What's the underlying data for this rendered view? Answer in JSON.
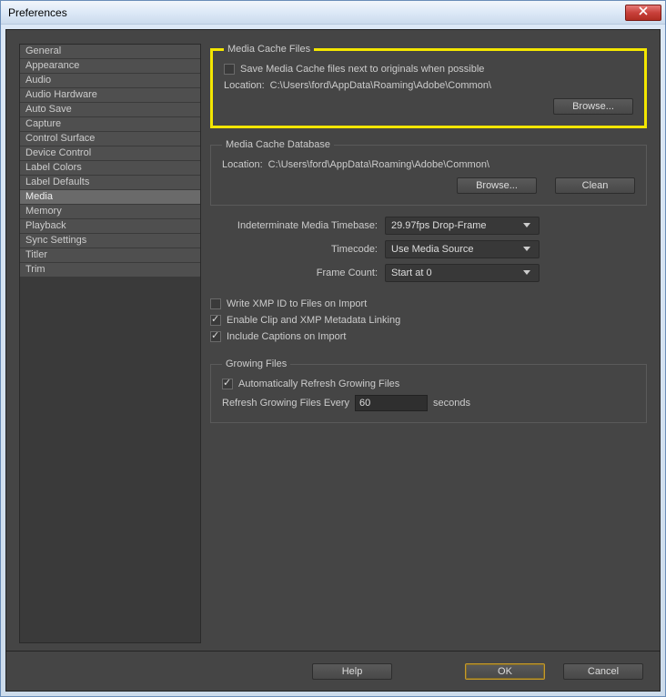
{
  "window": {
    "title": "Preferences"
  },
  "sidebar": {
    "items": [
      "General",
      "Appearance",
      "Audio",
      "Audio Hardware",
      "Auto Save",
      "Capture",
      "Control Surface",
      "Device Control",
      "Label Colors",
      "Label Defaults",
      "Media",
      "Memory",
      "Playback",
      "Sync Settings",
      "Titler",
      "Trim"
    ],
    "selected_index": 10
  },
  "media_cache_files": {
    "legend": "Media Cache Files",
    "save_next_to_label": "Save Media Cache files next to originals when possible",
    "save_next_to_checked": false,
    "location_label": "Location:",
    "location_value": "C:\\Users\\ford\\AppData\\Roaming\\Adobe\\Common\\",
    "browse_label": "Browse..."
  },
  "media_cache_db": {
    "legend": "Media Cache Database",
    "location_label": "Location:",
    "location_value": "C:\\Users\\ford\\AppData\\Roaming\\Adobe\\Common\\",
    "browse_label": "Browse...",
    "clean_label": "Clean"
  },
  "timebase": {
    "indeterminate_label": "Indeterminate Media Timebase:",
    "indeterminate_value": "29.97fps Drop-Frame",
    "timecode_label": "Timecode:",
    "timecode_value": "Use Media Source",
    "framecount_label": "Frame Count:",
    "framecount_value": "Start at 0"
  },
  "options": {
    "xmp_id_label": "Write XMP ID to Files on Import",
    "xmp_id_checked": false,
    "clip_linking_label": "Enable Clip and XMP Metadata Linking",
    "clip_linking_checked": true,
    "captions_label": "Include Captions on Import",
    "captions_checked": true
  },
  "growing": {
    "legend": "Growing Files",
    "auto_refresh_label": "Automatically Refresh Growing Files",
    "auto_refresh_checked": true,
    "refresh_every_label": "Refresh Growing Files Every",
    "refresh_every_value": "60",
    "seconds_label": "seconds"
  },
  "footer": {
    "help": "Help",
    "ok": "OK",
    "cancel": "Cancel"
  }
}
